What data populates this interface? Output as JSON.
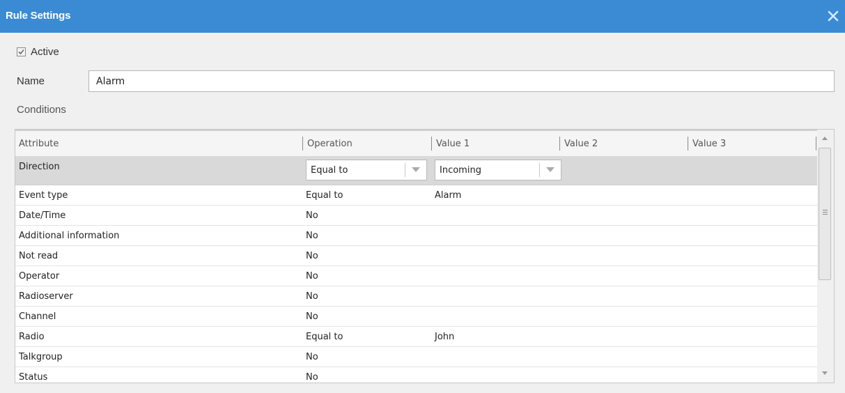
{
  "window": {
    "title": "Rule Settings",
    "close_icon": "close-icon"
  },
  "form": {
    "active_label": "Active",
    "active_checked": true,
    "name_label": "Name",
    "name_value": "Alarm",
    "conditions_label": "Conditions"
  },
  "grid": {
    "columns": [
      "Attribute",
      "Operation",
      "Value 1",
      "Value 2",
      "Value 3"
    ],
    "selected_row": {
      "attribute": "Direction",
      "operation": "Equal to",
      "value1": "Incoming"
    },
    "rows": [
      {
        "attribute": "Event type",
        "operation": "Equal to",
        "value1": "Alarm"
      },
      {
        "attribute": "Date/Time",
        "operation": "No",
        "value1": ""
      },
      {
        "attribute": "Additional information",
        "operation": "No",
        "value1": ""
      },
      {
        "attribute": "Not read",
        "operation": "No",
        "value1": ""
      },
      {
        "attribute": "Operator",
        "operation": "No",
        "value1": ""
      },
      {
        "attribute": "Radioserver",
        "operation": "No",
        "value1": ""
      },
      {
        "attribute": "Channel",
        "operation": "No",
        "value1": ""
      },
      {
        "attribute": "Radio",
        "operation": "Equal to",
        "value1": "John"
      },
      {
        "attribute": "Talkgroup",
        "operation": "No",
        "value1": ""
      },
      {
        "attribute": "Status",
        "operation": "No",
        "value1": ""
      }
    ]
  },
  "colors": {
    "titlebar": "#3b8ad4",
    "selected_row": "#d9d9d9"
  }
}
